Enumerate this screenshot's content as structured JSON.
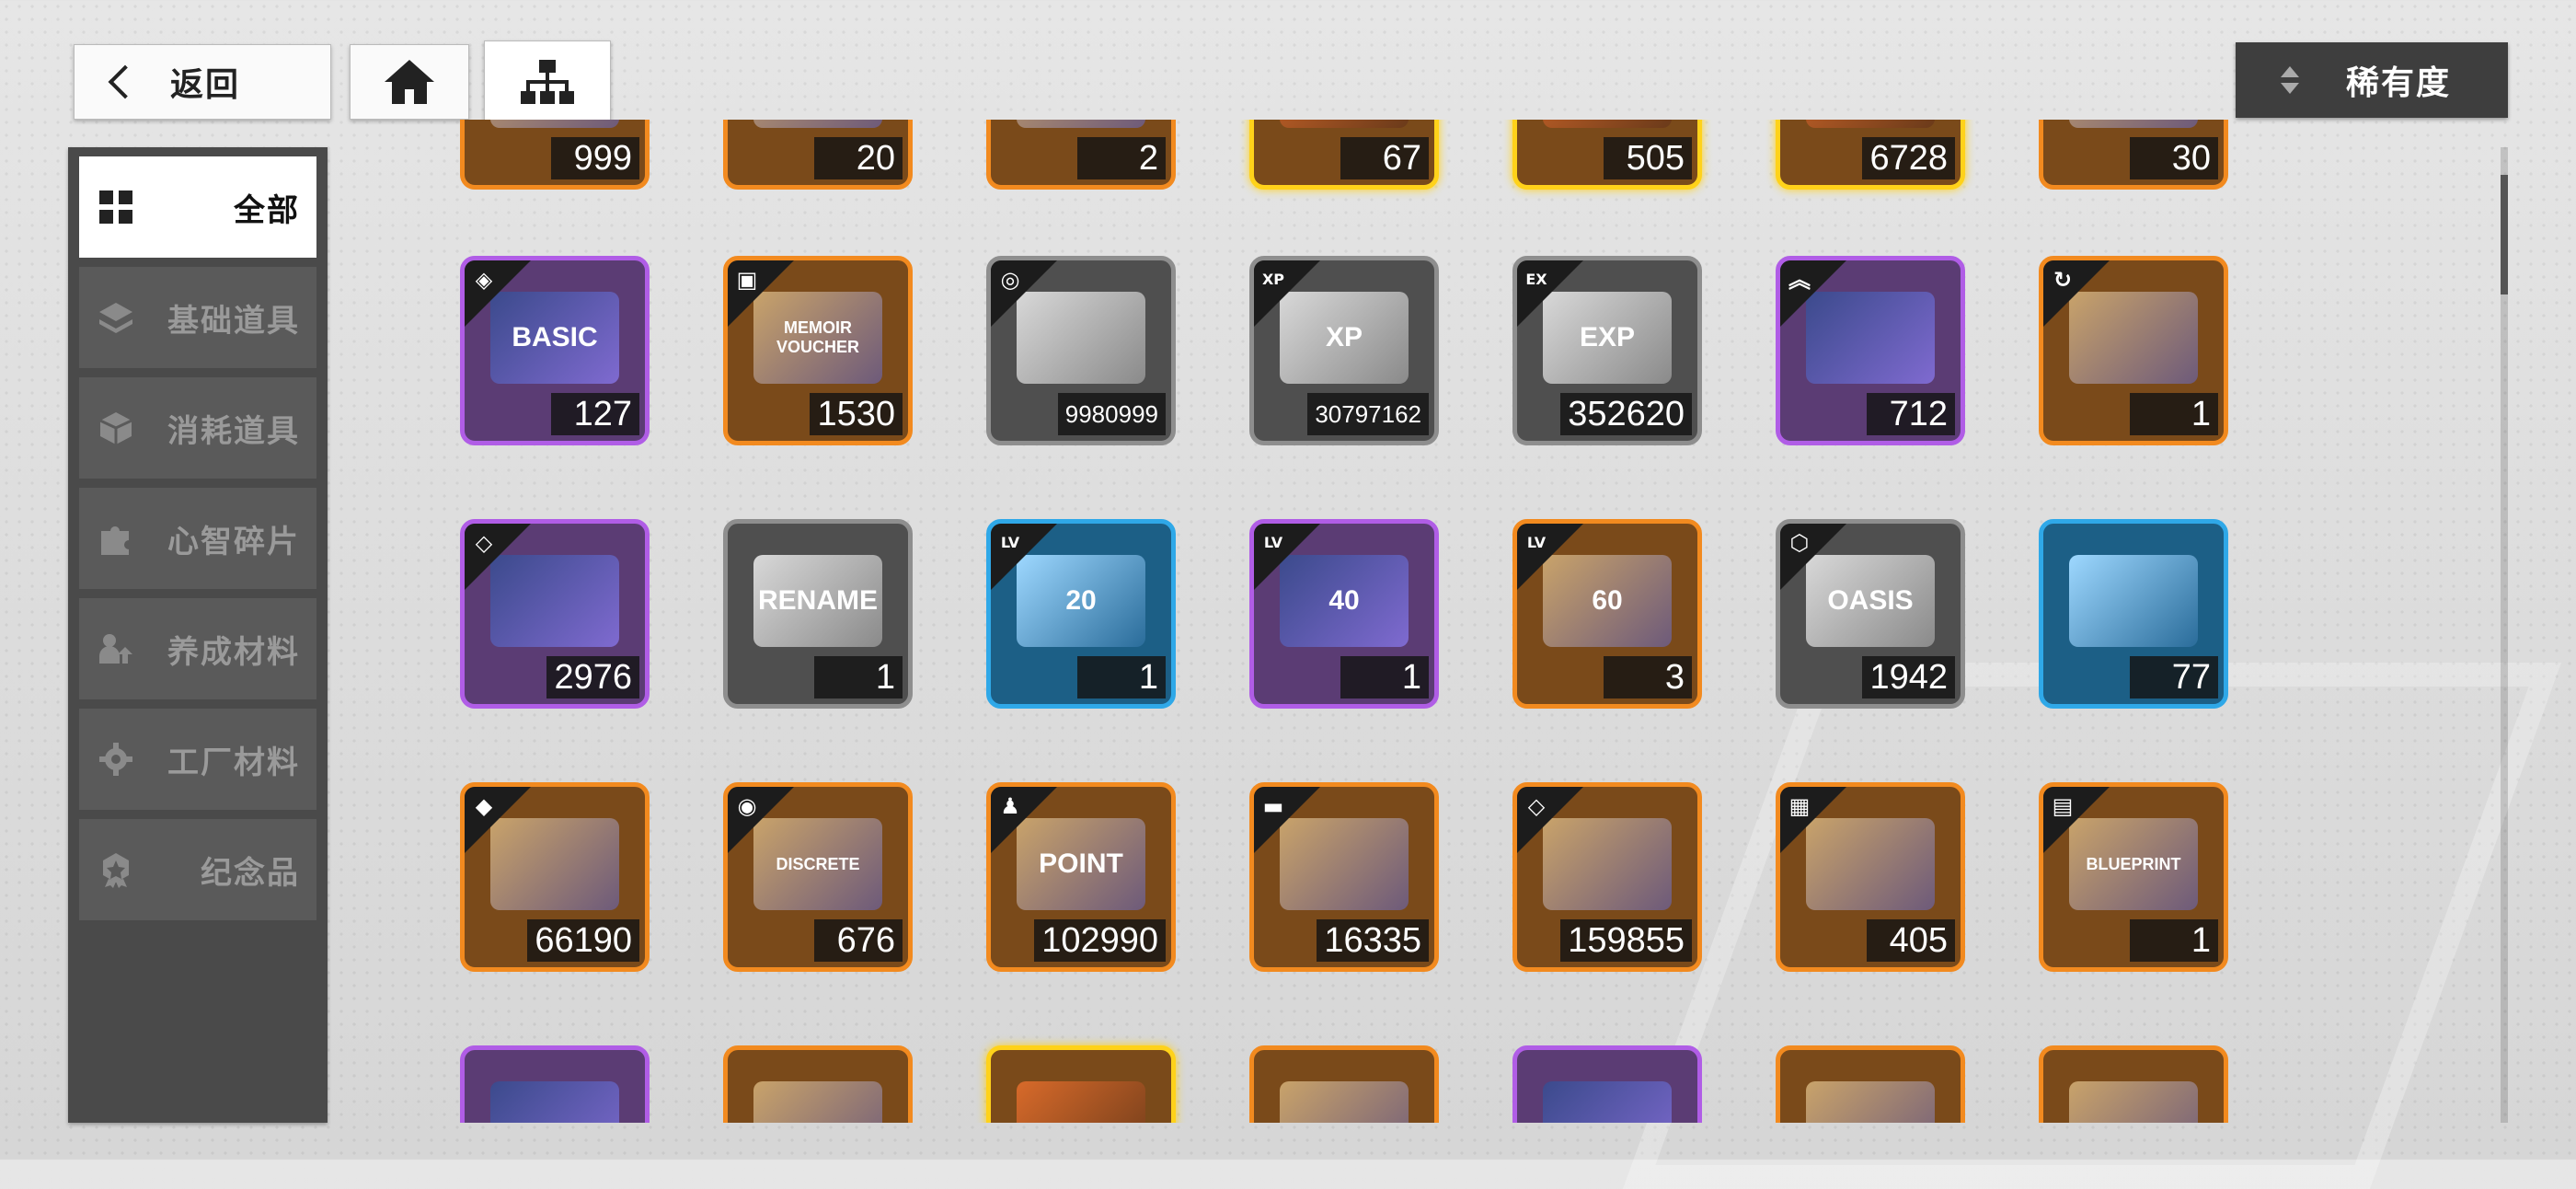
{
  "topbar": {
    "back_label": "返回",
    "sort_label": "稀有度"
  },
  "sidebar": {
    "items": [
      {
        "label": "全部",
        "icon": "grid-icon",
        "active": true
      },
      {
        "label": "基础道具",
        "icon": "layers-icon",
        "active": false
      },
      {
        "label": "消耗道具",
        "icon": "cube-icon",
        "active": false
      },
      {
        "label": "心智碎片",
        "icon": "puzzle-icon",
        "active": false
      },
      {
        "label": "养成材料",
        "icon": "user-up-icon",
        "active": false
      },
      {
        "label": "工厂材料",
        "icon": "gear-icon",
        "active": false
      },
      {
        "label": "纪念品",
        "icon": "badge-icon",
        "active": false
      }
    ]
  },
  "inventory": {
    "rows": [
      [
        {
          "count": "999",
          "rarity": "orange"
        },
        {
          "count": "20",
          "rarity": "orange"
        },
        {
          "count": "2",
          "rarity": "orange"
        },
        {
          "count": "67",
          "rarity": "gold"
        },
        {
          "count": "505",
          "rarity": "gold"
        },
        {
          "count": "6728",
          "rarity": "gold"
        },
        {
          "count": "30",
          "rarity": "orange"
        }
      ],
      [
        {
          "count": "127",
          "rarity": "purple",
          "icon": "diamond-icon",
          "art": "BASIC"
        },
        {
          "count": "1530",
          "rarity": "orange",
          "icon": "gift-icon",
          "art": "MEMOIR VOUCHER"
        },
        {
          "count": "9980999",
          "rarity": "gray",
          "icon": "coin-icon",
          "art": ""
        },
        {
          "count": "30797162",
          "rarity": "gray",
          "icon": "xp-icon",
          "art": "XP"
        },
        {
          "count": "352620",
          "rarity": "gray",
          "icon": "exp-icon",
          "art": "EXP"
        },
        {
          "count": "712",
          "rarity": "purple",
          "icon": "chevron-up-icon",
          "art": ""
        },
        {
          "count": "1",
          "rarity": "orange",
          "icon": "refresh-icon",
          "art": ""
        }
      ],
      [
        {
          "count": "2976",
          "rarity": "purple",
          "icon": "shard-icon",
          "art": ""
        },
        {
          "count": "1",
          "rarity": "gray",
          "icon": "",
          "art": "RENAME"
        },
        {
          "count": "1",
          "rarity": "blue",
          "icon": "lv-icon",
          "art": "20"
        },
        {
          "count": "1",
          "rarity": "purple",
          "icon": "lv-icon",
          "art": "40"
        },
        {
          "count": "3",
          "rarity": "orange",
          "icon": "lv-icon",
          "art": "60"
        },
        {
          "count": "1942",
          "rarity": "gray",
          "icon": "box-icon",
          "art": "OASIS"
        },
        {
          "count": "77",
          "rarity": "blue",
          "icon": "",
          "art": ""
        }
      ],
      [
        {
          "count": "66190",
          "rarity": "orange",
          "icon": "crystal-icon",
          "art": ""
        },
        {
          "count": "676",
          "rarity": "orange",
          "icon": "target-icon",
          "art": "DISCRETE"
        },
        {
          "count": "102990",
          "rarity": "orange",
          "icon": "person-icon",
          "art": "POINT"
        },
        {
          "count": "16335",
          "rarity": "orange",
          "icon": "roller-icon",
          "art": ""
        },
        {
          "count": "159855",
          "rarity": "orange",
          "icon": "diamonds-icon",
          "art": ""
        },
        {
          "count": "405",
          "rarity": "orange",
          "icon": "chip-icon",
          "art": ""
        },
        {
          "count": "1",
          "rarity": "orange",
          "icon": "book-icon",
          "art": "BLUEPRINT"
        }
      ],
      [
        {
          "count": "",
          "rarity": "purple"
        },
        {
          "count": "",
          "rarity": "orange"
        },
        {
          "count": "",
          "rarity": "gold"
        },
        {
          "count": "",
          "rarity": "orange"
        },
        {
          "count": "",
          "rarity": "purple"
        },
        {
          "count": "",
          "rarity": "orange"
        },
        {
          "count": "",
          "rarity": "orange"
        }
      ]
    ]
  }
}
